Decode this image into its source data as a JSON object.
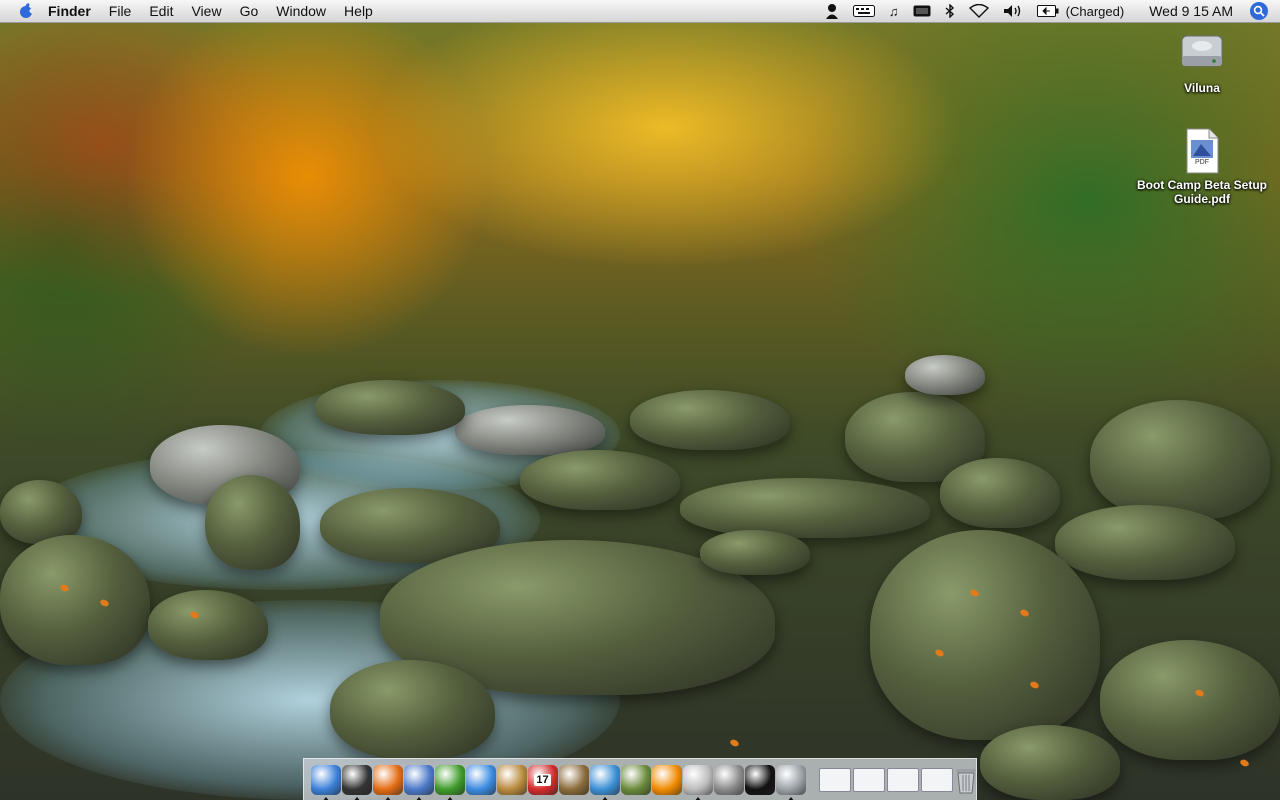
{
  "menubar": {
    "app": "Finder",
    "menus": [
      "File",
      "Edit",
      "View",
      "Go",
      "Window",
      "Help"
    ],
    "battery_status": "(Charged)",
    "clock": "Wed 9 15 AM",
    "extras_icons": [
      "user-icon",
      "keyboard-icon",
      "music-icon",
      "display-icon",
      "bluetooth-icon",
      "wifi-icon",
      "volume-icon",
      "battery-icon"
    ]
  },
  "desktop": {
    "icons": [
      {
        "label": "Viluna",
        "type": "hard-drive-icon"
      },
      {
        "label": "Boot Camp Beta Setup Guide.pdf",
        "type": "pdf-icon",
        "badge": "PDF"
      }
    ]
  },
  "dock": {
    "apps": [
      {
        "name": "finder-icon",
        "running": true,
        "color": "#3b7fd9"
      },
      {
        "name": "dashboard-icon",
        "running": true,
        "color": "#333333"
      },
      {
        "name": "firefox-icon",
        "running": true,
        "color": "#e36b12"
      },
      {
        "name": "preview-icon",
        "running": true,
        "color": "#4a78c8"
      },
      {
        "name": "adium-icon",
        "running": true,
        "color": "#3f9b2a"
      },
      {
        "name": "ichat-icon",
        "running": false,
        "color": "#3a8be0"
      },
      {
        "name": "address-book-icon",
        "running": false,
        "color": "#b8893c"
      },
      {
        "name": "ical-icon",
        "running": false,
        "color": "#d22a2a",
        "badge": "17"
      },
      {
        "name": "dictionary-icon",
        "running": false,
        "color": "#8a6a3a"
      },
      {
        "name": "itunes-icon",
        "running": true,
        "color": "#3c8fd6"
      },
      {
        "name": "textedit-icon",
        "running": false,
        "color": "#6a8a3a"
      },
      {
        "name": "vlc-icon",
        "running": false,
        "color": "#f08a00"
      },
      {
        "name": "automator-icon",
        "running": true,
        "color": "#bbbbbb"
      },
      {
        "name": "system-preferences-icon",
        "running": false,
        "color": "#8a8a8a"
      },
      {
        "name": "terminal-icon",
        "running": false,
        "color": "#111111"
      },
      {
        "name": "disk-utility-icon",
        "running": true,
        "color": "#9aa0a6"
      }
    ],
    "docs": [
      "window-thumb-1",
      "window-thumb-2",
      "window-thumb-3",
      "window-thumb-4"
    ],
    "trash": "trash-icon"
  }
}
